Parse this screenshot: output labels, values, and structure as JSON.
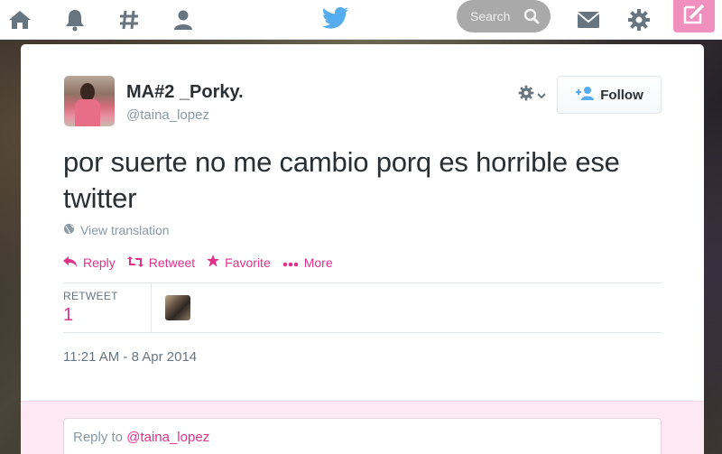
{
  "nav": {
    "items": [
      {
        "name": "home",
        "icon": "home-icon"
      },
      {
        "name": "notifications",
        "icon": "bell-icon"
      },
      {
        "name": "discover",
        "icon": "hashtag-icon"
      },
      {
        "name": "me",
        "icon": "user-icon"
      }
    ],
    "search": {
      "placeholder": "Search"
    },
    "icons": [
      "bird-logo-icon",
      "search-icon",
      "envelope-icon",
      "gear-icon",
      "compose-icon"
    ],
    "colors": {
      "accent": "#e0318b",
      "compose_bg": "#f18fbf",
      "bird": "#55acee",
      "search_bg": "#a9a9a9"
    }
  },
  "tweet": {
    "display_name": "MA#2 _Porky.",
    "screen_name": "@taina_lopez",
    "follow_label": "Follow",
    "text": "por suerte no me cambio porq es horrible ese twitter",
    "translation_label": "View translation",
    "actions": {
      "reply": "Reply",
      "retweet": "Retweet",
      "favorite": "Favorite",
      "more": "More"
    },
    "stats": {
      "label": "RETWEET",
      "count": "1"
    },
    "timestamp": "11:21 AM - 8 Apr 2014"
  },
  "reply": {
    "prefix": "Reply to ",
    "mention": "@taina_lopez"
  }
}
